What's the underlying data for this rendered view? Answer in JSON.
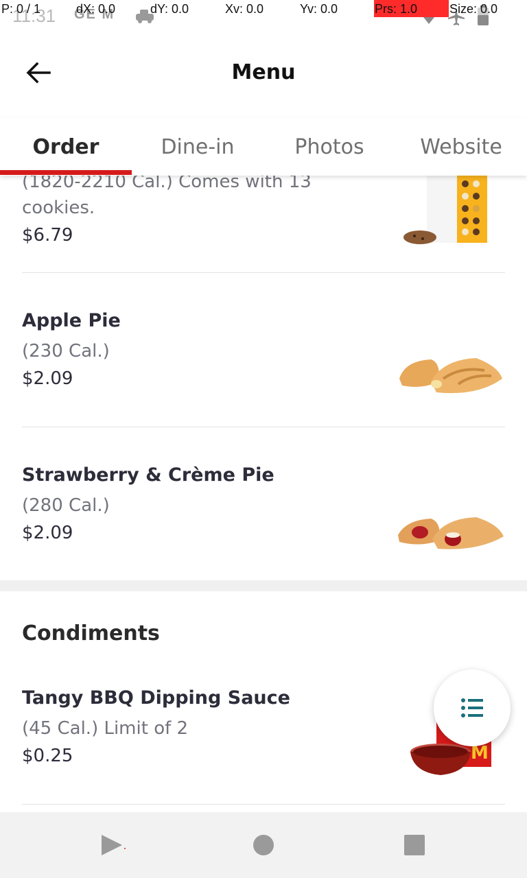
{
  "status_bar": {
    "time": "11:31",
    "left_icons_text": "GE M",
    "overlay": {
      "p": "P: 0 / 1",
      "dx": "dX: 0.0",
      "dy": "dY: 0.0",
      "xv": "Xv: 0.0",
      "yv": "Yv: 0.0",
      "prs": "Prs: 1.0",
      "size": "Size: 0.0"
    }
  },
  "app_bar": {
    "title": "Menu",
    "back_icon": "arrow-left-icon"
  },
  "tabs": [
    {
      "label": "Order",
      "active": true
    },
    {
      "label": "Dine-in",
      "active": false
    },
    {
      "label": "Photos",
      "active": false
    },
    {
      "label": "Website",
      "active": false
    }
  ],
  "items": [
    {
      "name": "",
      "desc_line1": "(1820-2210 Cal.) Comes with 13",
      "desc_line2": "cookies.",
      "price": "$6.79",
      "image": "cookie-tote-image"
    },
    {
      "name": "Apple Pie",
      "desc": "(230 Cal.)",
      "price": "$2.09",
      "image": "apple-pie-image"
    },
    {
      "name": "Strawberry & Crème Pie",
      "desc": "(280 Cal.)",
      "price": "$2.09",
      "image": "strawberry-pie-image"
    }
  ],
  "section": {
    "title": "Condiments",
    "items": [
      {
        "name": "Tangy BBQ Dipping Sauce",
        "desc": "(45 Cal.) Limit of 2",
        "price": "$0.25",
        "image": "bbq-sauce-image"
      }
    ]
  },
  "fab": {
    "icon": "list-icon"
  },
  "colors": {
    "accent": "#d61a1a",
    "fab_icon": "#1b6f7c",
    "text": "#2c2c3a",
    "muted": "#72737c"
  }
}
